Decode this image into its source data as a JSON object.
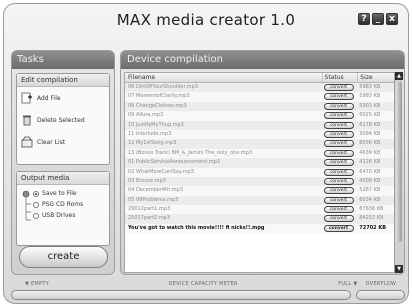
{
  "app": {
    "title": "MAX media creator 1.0"
  },
  "window_controls": {
    "help": "?",
    "minimize": "_",
    "close": "x"
  },
  "tasks": {
    "header": "Tasks",
    "edit": {
      "header": "Edit compilation",
      "items": [
        {
          "label": "Add File",
          "icon": "add-file-icon"
        },
        {
          "label": "Delete Selected",
          "icon": "delete-icon"
        },
        {
          "label": "Clear List",
          "icon": "clear-list-icon"
        }
      ]
    },
    "output": {
      "header": "Output media",
      "drives": [
        {
          "label": "Save to File",
          "selected": true
        },
        {
          "label": "PSG CD Roms",
          "selected": false
        },
        {
          "label": "USB Drives",
          "selected": false
        }
      ]
    },
    "create_label": "create"
  },
  "compilation": {
    "header": "Device compilation",
    "columns": {
      "name": "Filename",
      "status": "Status",
      "size": "Size"
    },
    "rows": [
      {
        "name": "06 DirtOffYourShoulder.mp3",
        "status": "convert",
        "size": "5983 KB",
        "highlight": false
      },
      {
        "name": "07 MomentofClarity.mp3",
        "status": "convert",
        "size": "5993 KB",
        "highlight": false
      },
      {
        "name": "08 ChangeClothes.mp3",
        "status": "convert",
        "size": "5903 KB",
        "highlight": false
      },
      {
        "name": "09 Allure.mp3",
        "status": "convert",
        "size": "6025 KB",
        "highlight": false
      },
      {
        "name": "10 JustifyMyThug.mp3",
        "status": "convert",
        "size": "6178 KB",
        "highlight": false
      },
      {
        "name": "11 Interlude.mp3",
        "status": "convert",
        "size": "3094 KB",
        "highlight": false
      },
      {
        "name": "12 My1stSong.mp3",
        "status": "convert",
        "size": "8036 KB",
        "highlight": false
      },
      {
        "name": "13 (Bonus Track) BM_&_Jamini The_only_one.mp3",
        "status": "convert",
        "size": "4639 KB",
        "highlight": false
      },
      {
        "name": "01 PublicServiceAnnouncement.mp3",
        "status": "convert",
        "size": "4126 KB",
        "highlight": false
      },
      {
        "name": "02 WhatMoreCanISay.mp3",
        "status": "convert",
        "size": "6470 KB",
        "highlight": false
      },
      {
        "name": "03 Encore.mp3",
        "status": "convert",
        "size": "4008 KB",
        "highlight": false
      },
      {
        "name": "04 December4th.mp3",
        "status": "convert",
        "size": "5287 KB",
        "highlight": false
      },
      {
        "name": "05 99Problems.mp3",
        "status": "convert",
        "size": "6034 KB",
        "highlight": false
      },
      {
        "name": "29012part1.mp3",
        "status": "convert",
        "size": "87636 KB",
        "highlight": false
      },
      {
        "name": "25017part2.mp3",
        "status": "convert",
        "size": "84202 KB",
        "highlight": false
      },
      {
        "name": "You've got to watch this movie!!!! fi nicks!!.mpg",
        "status": "convert",
        "size": "72702 KB",
        "highlight": true
      }
    ]
  },
  "capacity": {
    "empty_label": "EMPTY",
    "title": "DEVICE CAPACITY METER",
    "full_label": "FULL",
    "overflow_label": "OVERFLOW",
    "fill_fraction": 0.0
  }
}
